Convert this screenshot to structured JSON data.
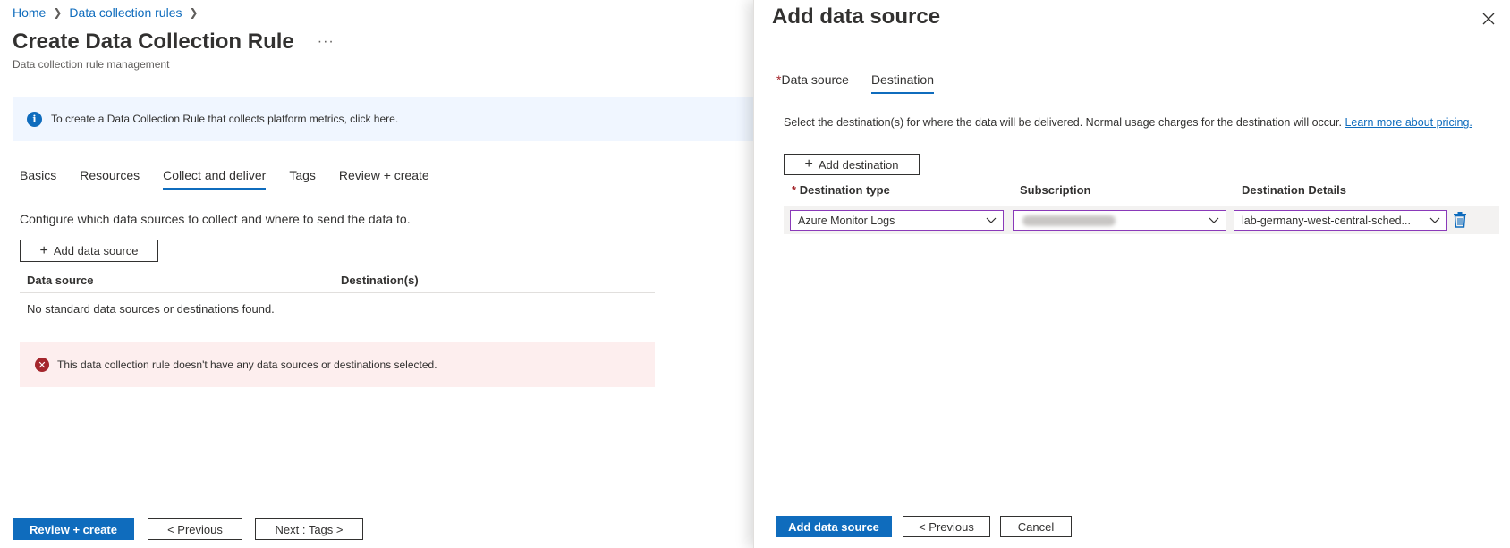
{
  "breadcrumb": {
    "home": "Home",
    "rules": "Data collection rules",
    "separator": ">"
  },
  "page": {
    "title": "Create Data Collection Rule",
    "more": "...",
    "subtitle": "Data collection rule management"
  },
  "info_bar": {
    "icon": "i",
    "text": "To create a Data Collection Rule that collects platform metrics, click here."
  },
  "tabs": [
    {
      "label": "Basics"
    },
    {
      "label": "Resources"
    },
    {
      "label": "Collect and deliver",
      "active": true
    },
    {
      "label": "Tags"
    },
    {
      "label": "Review + create"
    }
  ],
  "collect": {
    "description": "Configure which data sources to collect and where to send the data to.",
    "add_button": "Add data source",
    "table_headers": [
      "Data source",
      "Destination(s)"
    ],
    "empty_text": "No standard data sources or destinations found."
  },
  "error_bar": {
    "icon": "x",
    "text": "This data collection rule doesn't have any data sources or destinations selected."
  },
  "left_footer": {
    "review_button": "Review + create",
    "previous_button": "< Previous",
    "next_button": "Next : Tags >"
  },
  "panel": {
    "title": "Add data source",
    "close_icon": "close-icon",
    "tabs": [
      {
        "label": "Data source",
        "required": "*"
      },
      {
        "label": "Destination",
        "active": true
      }
    ],
    "description": "Select the destination(s) for where the data will be delivered. Normal usage charges for the destination will occur.",
    "learn_more": "Learn more about pricing.",
    "add_destination_button": "Add destination",
    "columns": {
      "type": "Destination type",
      "type_required": "*",
      "subscription": "Subscription",
      "details": "Destination Details"
    },
    "row": {
      "type_value": "Azure Monitor Logs",
      "subscription_value": "",
      "details_value": "lab-germany-west-central-sched..."
    },
    "footer": {
      "add_button": "Add data source",
      "previous_button": "< Previous",
      "cancel_button": "Cancel"
    }
  },
  "colors": {
    "accent": "#0f6cbd",
    "info_bg": "#f0f6ff",
    "error_bg": "#fdeeee",
    "error_icon": "#a4262c",
    "select_border": "#8a3ab9"
  }
}
